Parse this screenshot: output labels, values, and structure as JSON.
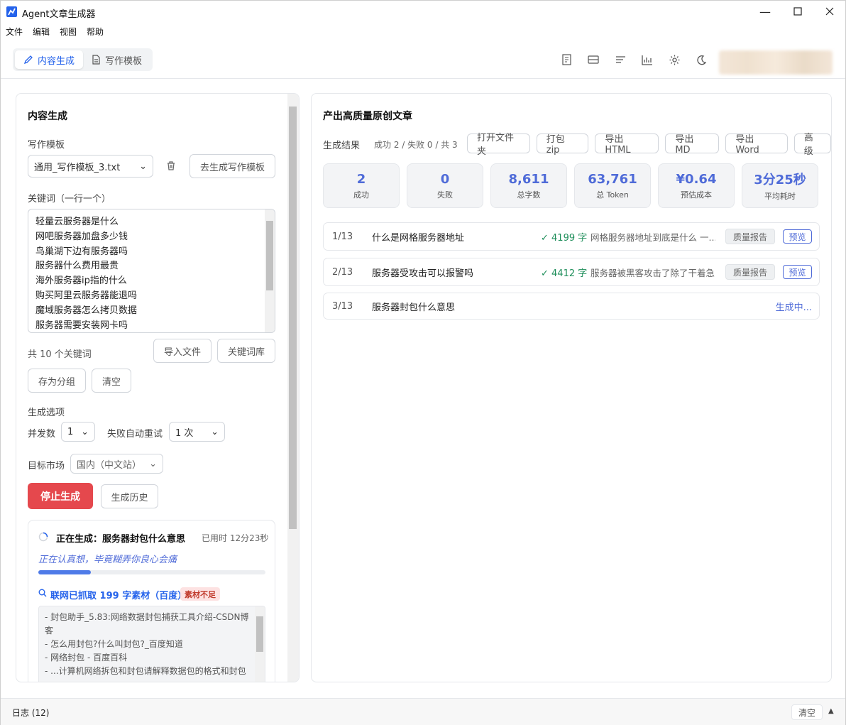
{
  "window": {
    "title": "Agent文章生成器"
  },
  "menu": [
    "文件",
    "编辑",
    "视图",
    "帮助"
  ],
  "tabs": [
    {
      "label": "内容生成",
      "active": true
    },
    {
      "label": "写作模板",
      "active": false
    }
  ],
  "toolbar_icons": [
    "document-icon",
    "layout-icon",
    "list-icon",
    "chart-icon",
    "gear-icon",
    "moon-icon"
  ],
  "left": {
    "title": "内容生成",
    "template_label": "写作模板",
    "template_value": "通用_写作模板_3.txt",
    "goto_template": "去生成写作模板",
    "keywords_label": "关键词（一行一个）",
    "keywords": [
      "轻量云服务器是什么",
      "网吧服务器加盘多少钱",
      "鸟巢湖下边有服务器吗",
      "服务器什么费用最贵",
      "海外服务器ip指的什么",
      "购买阿里云服务器能退吗",
      "魔域服务器怎么拷贝数据",
      "服务器需要安装网卡吗"
    ],
    "keyword_count": "共 10 个关键词",
    "import_file": "导入文件",
    "keyword_lib": "关键词库",
    "save_group": "存为分组",
    "clear": "清空",
    "options_label": "生成选项",
    "concurrency_label": "并发数",
    "concurrency_value": "1",
    "retry_label": "失败自动重试",
    "retry_value": "1 次",
    "market_label": "目标市场",
    "market_value": "国内（中文站）",
    "stop": "停止生成",
    "history": "生成历史",
    "gen": {
      "title": "正在生成：服务器封包什么意思",
      "elapsed": "已用时 12分23秒",
      "thinking": "正在认真想，毕竟糊弄你良心会痛",
      "progress": 0.23,
      "fetch": "联网已抓取 199 字素材（百度）",
      "badge": "素材不足",
      "sources": [
        "- 封包助手_5.83:网络数据封包捕获工具介绍-CSDN博",
        "客",
        "- 怎么用封包?什么叫封包?_百度知道",
        "- 网络封包 - 百度百科",
        "- ...计算机网络拆包和封包请解释数据包的格式和封包"
      ]
    }
  },
  "right": {
    "title": "产出高质量原创文章",
    "results_label": "生成结果",
    "summary": "成功 2 / 失败 0 / 共 3",
    "actions": [
      "打开文件夹",
      "打包 zip",
      "导出 HTML",
      "导出 MD",
      "导出 Word",
      "高级"
    ],
    "stats": [
      {
        "value": "2",
        "label": "成功"
      },
      {
        "value": "0",
        "label": "失败"
      },
      {
        "value": "8,611",
        "label": "总字数"
      },
      {
        "value": "63,761",
        "label": "总 Token"
      },
      {
        "value": "¥0.64",
        "label": "预估成本"
      },
      {
        "value": "3分25秒",
        "label": "平均耗时"
      }
    ],
    "rows": [
      {
        "idx": "1/13",
        "title": "什么是网格服务器地址",
        "count": "✓ 4199 字",
        "summary": "网格服务器地址到底是什么 一...",
        "quality": "质量报告",
        "preview": "预览"
      },
      {
        "idx": "2/13",
        "title": "服务器受攻击可以报警吗",
        "count": "✓ 4412 字",
        "summary": "服务器被黑客攻击了除了干着急...",
        "quality": "质量报告",
        "preview": "预览"
      },
      {
        "idx": "3/13",
        "title": "服务器封包什么意思",
        "status": "生成中..."
      }
    ]
  },
  "status": {
    "log": "日志 (12)",
    "clear": "清空"
  }
}
